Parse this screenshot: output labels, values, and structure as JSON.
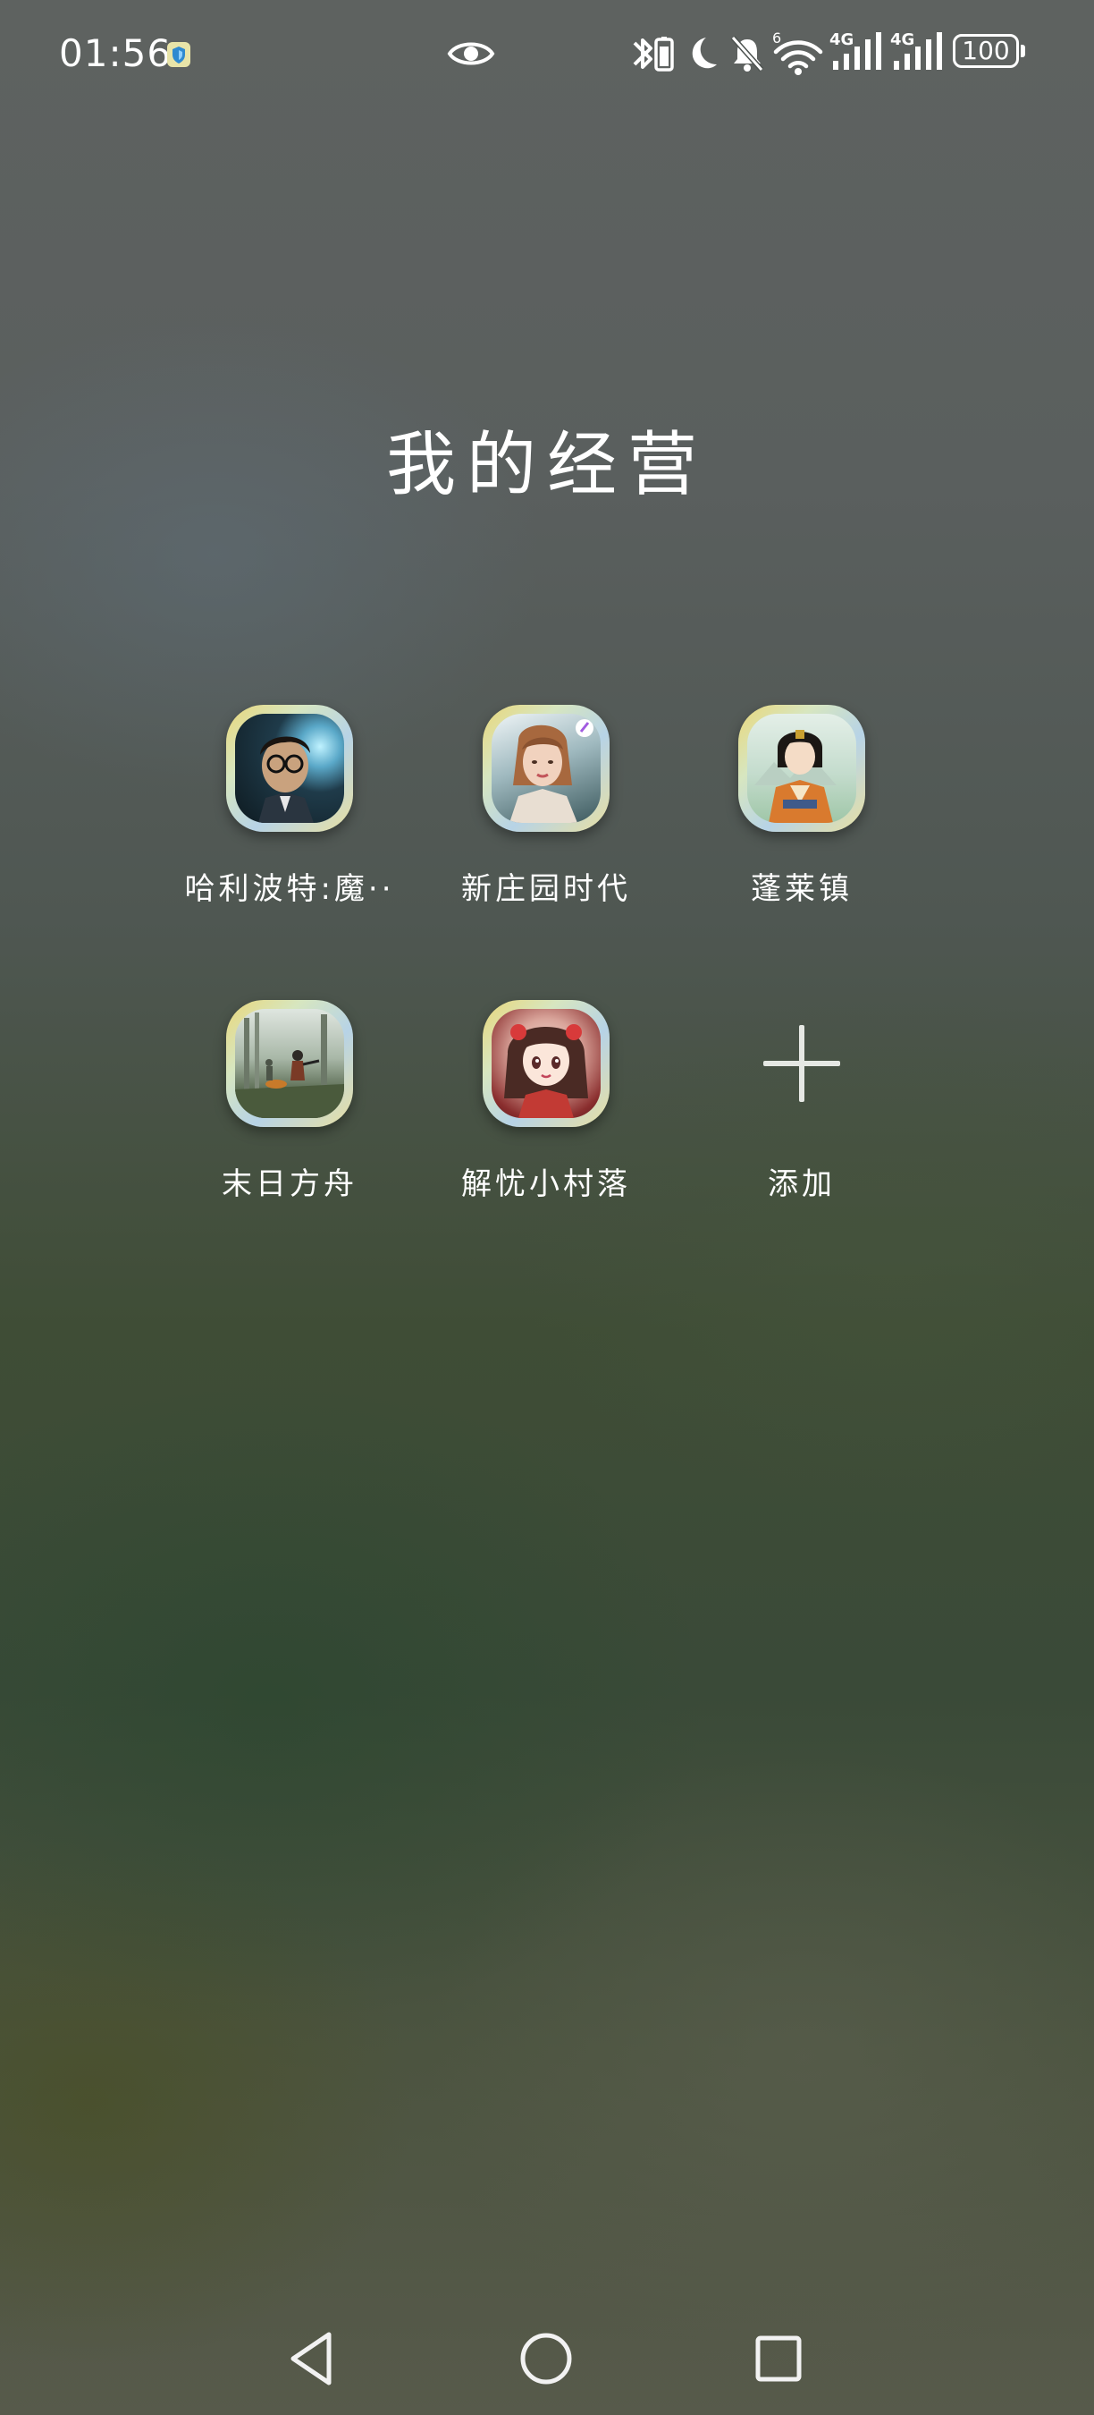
{
  "status_bar": {
    "time": "01:56",
    "battery_level": "100",
    "signal_1_label": "4G",
    "signal_2_label": "4G",
    "wifi_label": "6"
  },
  "folder": {
    "title": "我的经营",
    "apps": [
      {
        "label": "哈利波特:魔··",
        "icon": "harry-potter-app-icon"
      },
      {
        "label": "新庄园时代",
        "icon": "new-manor-era-app-icon"
      },
      {
        "label": "蓬莱镇",
        "icon": "penglai-town-app-icon"
      },
      {
        "label": "末日方舟",
        "icon": "doomsday-ark-app-icon"
      },
      {
        "label": "解忧小村落",
        "icon": "worry-free-village-app-icon"
      }
    ],
    "add_label": "添加"
  },
  "nav": {
    "back": "back-triangle-icon",
    "home": "home-circle-icon",
    "recents": "recents-square-icon"
  }
}
